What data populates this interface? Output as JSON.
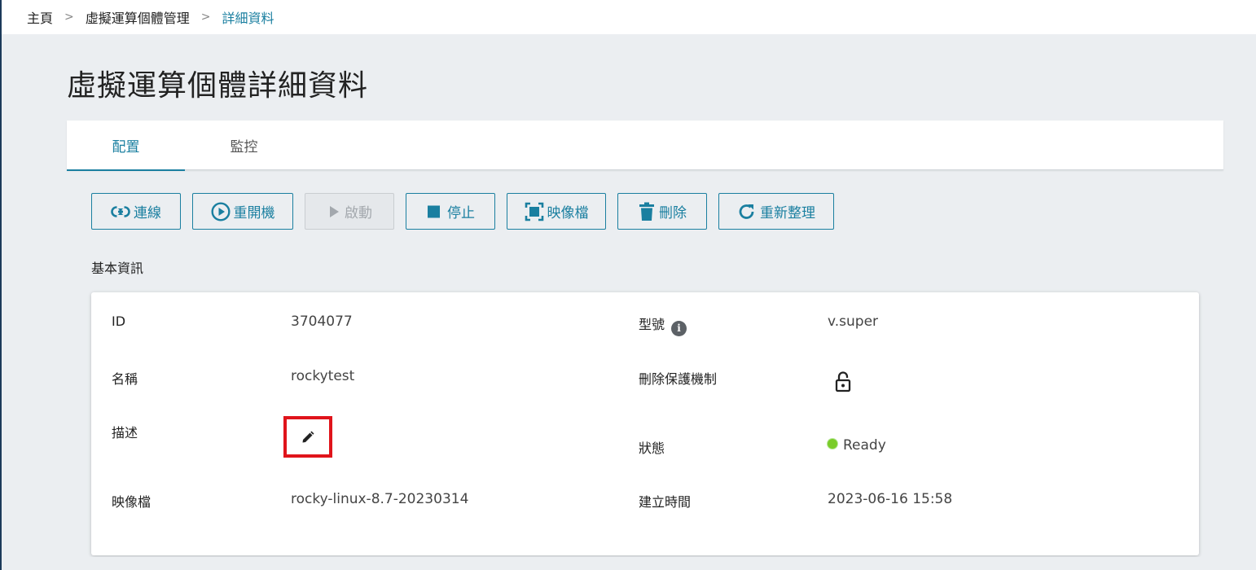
{
  "breadcrumb": {
    "items": [
      {
        "label": "主頁"
      },
      {
        "label": "虛擬運算個體管理"
      },
      {
        "label": "詳細資料"
      }
    ],
    "separator": ">"
  },
  "page": {
    "title": "虛擬運算個體詳細資料"
  },
  "tabs": [
    {
      "label": "配置",
      "active": true
    },
    {
      "label": "監控",
      "active": false
    }
  ],
  "toolbar": {
    "connect": {
      "label": "連線",
      "icon": "link-icon",
      "enabled": true
    },
    "reboot": {
      "label": "重開機",
      "icon": "play-circle-icon",
      "enabled": true
    },
    "start": {
      "label": "啟動",
      "icon": "play-icon",
      "enabled": false
    },
    "stop": {
      "label": "停止",
      "icon": "stop-icon",
      "enabled": true
    },
    "image": {
      "label": "映像檔",
      "icon": "image-capture-icon",
      "enabled": true
    },
    "delete": {
      "label": "刪除",
      "icon": "trash-icon",
      "enabled": true
    },
    "refresh": {
      "label": "重新整理",
      "icon": "refresh-icon",
      "enabled": true
    }
  },
  "basic_info": {
    "section_title": "基本資訊",
    "id": {
      "label": "ID",
      "value": "3704077"
    },
    "name": {
      "label": "名稱",
      "value": "rockytest"
    },
    "description": {
      "label": "描述",
      "value": "",
      "edit_icon": "pencil-icon"
    },
    "image": {
      "label": "映像檔",
      "value": "rocky-linux-8.7-20230314"
    },
    "flavor": {
      "label": "型號",
      "value": "v.super",
      "info_icon": "info-icon"
    },
    "delete_protection": {
      "label": "刪除保護機制",
      "icon": "unlocked-padlock-icon"
    },
    "status": {
      "label": "狀態",
      "value": "Ready",
      "color": "#7acc29"
    },
    "created_at": {
      "label": "建立時間",
      "value": "2023-06-16 15:58"
    }
  },
  "colors": {
    "accent": "#1a7fa0",
    "highlight_border": "#e0141b",
    "background": "#ebeef1"
  }
}
